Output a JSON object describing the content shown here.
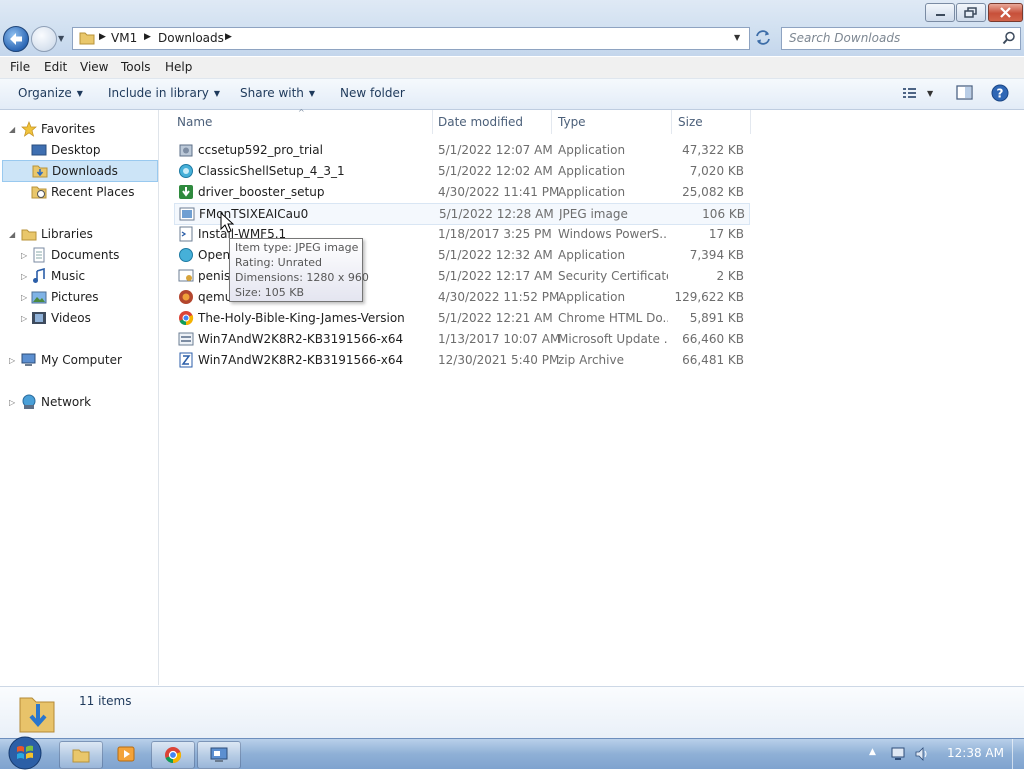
{
  "window": {
    "buttons": {
      "minimize": "minimize",
      "maximize": "restore",
      "close": "close"
    }
  },
  "address": {
    "crumbs": [
      "VM1",
      "Downloads"
    ],
    "search_placeholder": "Search Downloads"
  },
  "menubar": [
    "File",
    "Edit",
    "View",
    "Tools",
    "Help"
  ],
  "commandbar": {
    "organize": "Organize",
    "include_in_library": "Include in library",
    "share_with": "Share with",
    "new_folder": "New folder"
  },
  "nav": {
    "favorites": "Favorites",
    "desktop": "Desktop",
    "downloads": "Downloads",
    "recent_places": "Recent Places",
    "libraries": "Libraries",
    "documents": "Documents",
    "music": "Music",
    "pictures": "Pictures",
    "videos": "Videos",
    "my_computer": "My Computer",
    "network": "Network"
  },
  "columns": {
    "name": "Name",
    "date": "Date modified",
    "type": "Type",
    "size": "Size"
  },
  "files": [
    {
      "name": "ccsetup592_pro_trial",
      "date": "5/1/2022 12:07 AM",
      "type": "Application",
      "size": "47,322 KB",
      "icon": "installer-icon"
    },
    {
      "name": "ClassicShellSetup_4_3_1",
      "date": "5/1/2022 12:02 AM",
      "type": "Application",
      "size": "7,020 KB",
      "icon": "shell-icon"
    },
    {
      "name": "driver_booster_setup",
      "date": "4/30/2022 11:41 PM",
      "type": "Application",
      "size": "25,082 KB",
      "icon": "driver-icon"
    },
    {
      "name": "FMonTSIXEAICau0",
      "date": "5/1/2022 12:28 AM",
      "type": "JPEG image",
      "size": "106 KB",
      "icon": "image-icon"
    },
    {
      "name": "Install-WMF5.1",
      "date": "1/18/2017 3:25 PM",
      "type": "Windows PowerS...",
      "size": "17 KB",
      "icon": "script-icon"
    },
    {
      "name": "Open",
      "date": "5/1/2022 12:32 AM",
      "type": "Application",
      "size": "7,394 KB",
      "icon": "app-icon"
    },
    {
      "name": "penis",
      "date": "5/1/2022 12:17 AM",
      "type": "Security Certificate",
      "size": "2 KB",
      "icon": "certificate-icon"
    },
    {
      "name": "qemu",
      "date": "4/30/2022 11:52 PM",
      "type": "Application",
      "size": "129,622 KB",
      "icon": "qemu-icon"
    },
    {
      "name": "The-Holy-Bible-King-James-Version",
      "date": "5/1/2022 12:21 AM",
      "type": "Chrome HTML Do...",
      "size": "5,891 KB",
      "icon": "chrome-icon"
    },
    {
      "name": "Win7AndW2K8R2-KB3191566-x64",
      "date": "1/13/2017 10:07 AM",
      "type": "Microsoft Update ...",
      "size": "66,460 KB",
      "icon": "update-icon"
    },
    {
      "name": "Win7AndW2K8R2-KB3191566-x64",
      "date": "12/30/2021 5:40 PM",
      "type": "zip Archive",
      "size": "66,481 KB",
      "icon": "zip-icon"
    }
  ],
  "tooltip": {
    "type": "Item type: JPEG image",
    "rating": "Rating: Unrated",
    "dimensions": "Dimensions: 1280 x 960",
    "size": "Size: 105 KB"
  },
  "details": {
    "count": "11 items"
  },
  "taskbar": {
    "clock": "12:38 AM"
  },
  "colors": {
    "selection": "#cce4f7",
    "accent": "#1e395b",
    "taskbar": "#8fb0d6"
  }
}
